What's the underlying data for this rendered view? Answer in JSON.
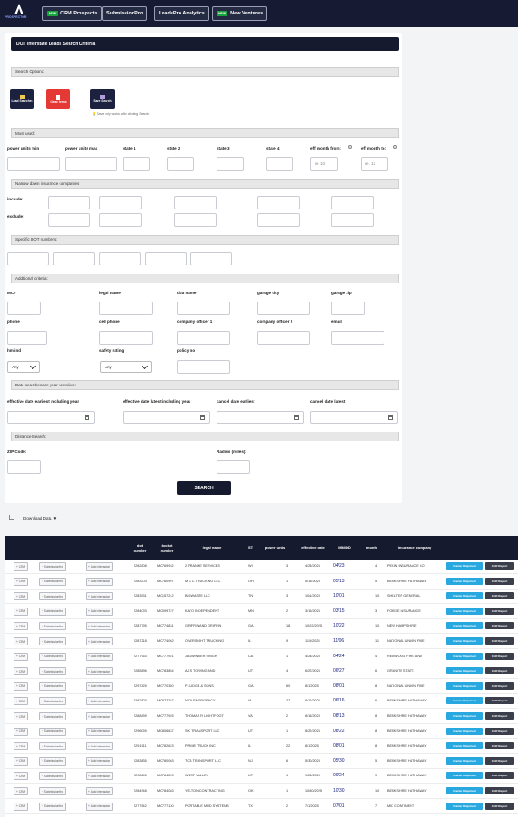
{
  "nav": {
    "logo_text": "PROSPECTOR",
    "buttons": [
      {
        "label": "CRM Prospects",
        "new": true
      },
      {
        "label": "SubmissionPro",
        "new": false
      },
      {
        "label": "LeadsPro Analytics",
        "new": false
      },
      {
        "label": "New Ventures",
        "new": true
      }
    ],
    "new_tag": "NEW"
  },
  "panel": {
    "title": "DOT Interstate Leads Search Criteria",
    "search_options": "Search Options:",
    "buttons": {
      "load": "Load Searches",
      "clear": "Clear Items",
      "save": "Save Search"
    },
    "hint": "Save only works after clicking Search",
    "most_used": "Most used:",
    "fields": {
      "power_units_min": "power units min",
      "power_units_max": "power units max",
      "state1": "state 1",
      "state2": "state 2",
      "state3": "state 3",
      "state4": "state 4",
      "eff_month_from": "eff month from:",
      "eff_month_to": "eff month to:",
      "eff_from_ph": "ie. 10",
      "eff_to_ph": "ie. 12"
    },
    "insurance": "Narrow down insurance companies:",
    "include": "include:",
    "exclude": "exclude:",
    "dot_numbers": "Specific DOT numbers:",
    "additional": "Additional criteria:",
    "add_fields": {
      "mc": "MC#",
      "legal_name": "legal name",
      "dba_name": "dba name",
      "garage_city": "garage city",
      "garage_zip": "garage zip",
      "phone": "phone",
      "cell_phone": "cell phone",
      "officer1": "company officer 1",
      "officer2": "company officer 2",
      "email": "email",
      "hm_ind": "hm ind",
      "safety_rating": "safety rating",
      "policy_no": "policy no",
      "any": "Any"
    },
    "date_note": "Date searches are year-sensitive:",
    "date_fields": {
      "earliest_inc": "effective date earliest including year",
      "latest_inc": "effective date latest including year",
      "cancel_earliest": "cancel date earliest",
      "cancel_latest": "cancel date latest"
    },
    "distance": "Distance Search:",
    "zip_code": "ZIP Code:",
    "radius": "Radius (miles):",
    "search_btn": "SEARCH"
  },
  "download": {
    "label": "Download Data ▼"
  },
  "table": {
    "headers": [
      "dot number",
      "docket number",
      "legal name",
      "ST",
      "power units",
      "effective date",
      "MM/DD",
      "month",
      "insurance company"
    ],
    "chip_crm": "CRM",
    "chip_sub": "SubmissionPro",
    "chip_int": "Add Interaction",
    "carrier_req": "Carrier Required",
    "car_report": "CAR Report",
    "rows": [
      {
        "dot": "2282808",
        "docket": "MC769932",
        "name": "2 PRANKE SERVICES",
        "st": "WI",
        "pu": "3",
        "eff": "4/23/2025",
        "mmdd": "04/23",
        "month": "4",
        "ins": "PEKIN INSURANCE CO"
      },
      {
        "dot": "2283303",
        "docket": "MC760997",
        "name": "M & C TRUCKING LLC",
        "st": "OH",
        "pu": "1",
        "eff": "5/13/2025",
        "mmdd": "05/13",
        "month": "5",
        "ins": "BERKSHIRE HATHAWAY"
      },
      {
        "dot": "2283931",
        "docket": "MC157242",
        "name": "BIGWASTE LLC",
        "st": "TN",
        "pu": "3",
        "eff": "10/1/2025",
        "mmdd": "10/01",
        "month": "10",
        "ins": "SHELTER GENERAL"
      },
      {
        "dot": "2284093",
        "docket": "MC099727",
        "name": "KATO INDEPENDENT",
        "st": "MN",
        "pu": "2",
        "eff": "3/15/2025",
        "mmdd": "03/15",
        "month": "3",
        "ins": "FORGE INSURANCE"
      },
      {
        "dot": "2287795",
        "docket": "MC774831",
        "name": "GRIFFIN AND GRIFFIN",
        "st": "GA",
        "pu": "18",
        "eff": "10/22/2025",
        "mmdd": "10/22",
        "month": "10",
        "ins": "NEW HAMPSHIRE"
      },
      {
        "dot": "2287218",
        "docket": "MC774062",
        "name": "OVERSIGHT TRUCKING",
        "st": "IL",
        "pu": "9",
        "eff": "11/6/2025",
        "mmdd": "11/06",
        "month": "11",
        "ins": "NATIONAL UNION FIRE"
      },
      {
        "dot": "2277963",
        "docket": "MC777921",
        "name": "JASWINDER SINGH",
        "st": "CA",
        "pu": "1",
        "eff": "4/24/2025",
        "mmdd": "04/24",
        "month": "4",
        "ins": "REDWOOD FIRE AND"
      },
      {
        "dot": "2285896",
        "docket": "MC783854",
        "name": "AJ S TOWING AND",
        "st": "UT",
        "pu": "4",
        "eff": "6/27/2025",
        "mmdd": "06/27",
        "month": "6",
        "ins": "GRANITE STATE"
      },
      {
        "dot": "2297425",
        "docket": "MC770350",
        "name": "P JUDGE & SONS",
        "st": "GA",
        "pu": "60",
        "eff": "8/1/2025",
        "mmdd": "08/01",
        "month": "8",
        "ins": "NATIONAL UNION FIRE"
      },
      {
        "dot": "2282803",
        "docket": "MC872287",
        "name": "NOA EMERGENCY",
        "st": "IA",
        "pu": "27",
        "eff": "6/16/2025",
        "mmdd": "06/16",
        "month": "6",
        "ins": "BERKSHIRE HATHAWAY"
      },
      {
        "dot": "2288439",
        "docket": "MC777925",
        "name": "THOMAS R LIGHTFOOT",
        "st": "VA",
        "pu": "2",
        "eff": "8/13/2025",
        "mmdd": "08/13",
        "month": "8",
        "ins": "BERKSHIRE HATHAWAY"
      },
      {
        "dot": "2296059",
        "docket": "MC806637",
        "name": "SKI TRANSPORT LLC",
        "st": "UT",
        "pu": "1",
        "eff": "8/22/2025",
        "mmdd": "08/22",
        "month": "8",
        "ins": "BERKSHIRE HATHAWAY"
      },
      {
        "dot": "2291911",
        "docket": "MC782623",
        "name": "PRIME TRUCK INC",
        "st": "IL",
        "pu": "22",
        "eff": "8/1/2025",
        "mmdd": "08/01",
        "month": "8",
        "ins": "BERKSHIRE HATHAWAY"
      },
      {
        "dot": "2283835",
        "docket": "MC780063",
        "name": "TCB TRANSPORT LLC",
        "st": "NJ",
        "pu": "6",
        "eff": "5/30/2025",
        "mmdd": "05/30",
        "month": "5",
        "ins": "BERKSHIRE HATHAWAY"
      },
      {
        "dot": "2298645",
        "docket": "MC784223",
        "name": "WEST VALLEY",
        "st": "UT",
        "pu": "1",
        "eff": "9/24/2025",
        "mmdd": "09/24",
        "month": "9",
        "ins": "BERKSHIRE HATHAWAY"
      },
      {
        "dot": "2284948",
        "docket": "MC784083",
        "name": "YELTON CONTRACTING",
        "st": "OK",
        "pu": "1",
        "eff": "10/30/2025",
        "mmdd": "10/30",
        "month": "10",
        "ins": "BERKSHIRE HATHAWAY"
      },
      {
        "dot": "2277642",
        "docket": "MC777130",
        "name": "PORTABLE MUD SYSTEMS",
        "st": "TX",
        "pu": "2",
        "eff": "7/1/2025",
        "mmdd": "07/01",
        "month": "7",
        "ins": "MID CONTINENT"
      }
    ]
  }
}
